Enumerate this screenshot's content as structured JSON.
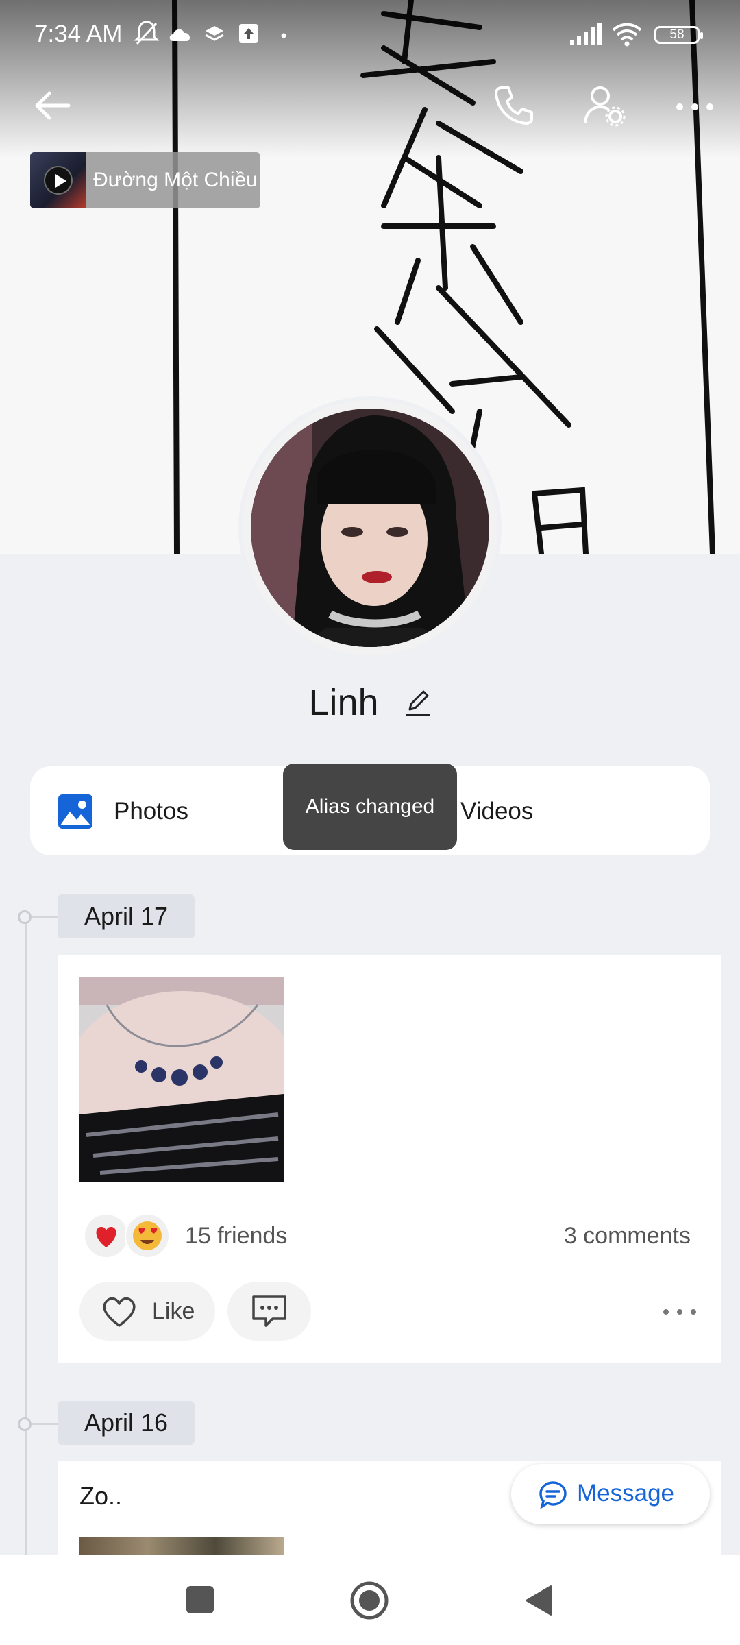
{
  "status_bar": {
    "time": "7:34 AM",
    "battery": "58"
  },
  "header": {
    "icons": [
      "back-arrow-icon",
      "phone-icon",
      "profile-settings-icon",
      "more-icon"
    ]
  },
  "music": {
    "title": "Đường Một Chiều"
  },
  "profile": {
    "name": "Linh"
  },
  "media_tabs": {
    "photos_label": "Photos",
    "videos_label": "Videos"
  },
  "toast": {
    "text": "Alias changed"
  },
  "timeline": {
    "posts": [
      {
        "date": "April 17",
        "reactions": [
          "heart",
          "heart-eyes"
        ],
        "friends_label": "15 friends",
        "comments_label": "3 comments",
        "like_label": "Like"
      },
      {
        "date": "April 16",
        "text": "Zo.."
      }
    ]
  },
  "message_button": {
    "label": "Message"
  },
  "colors": {
    "accent": "#1565d8",
    "page_background": "#eef0f4",
    "toast_background": "#454545"
  }
}
